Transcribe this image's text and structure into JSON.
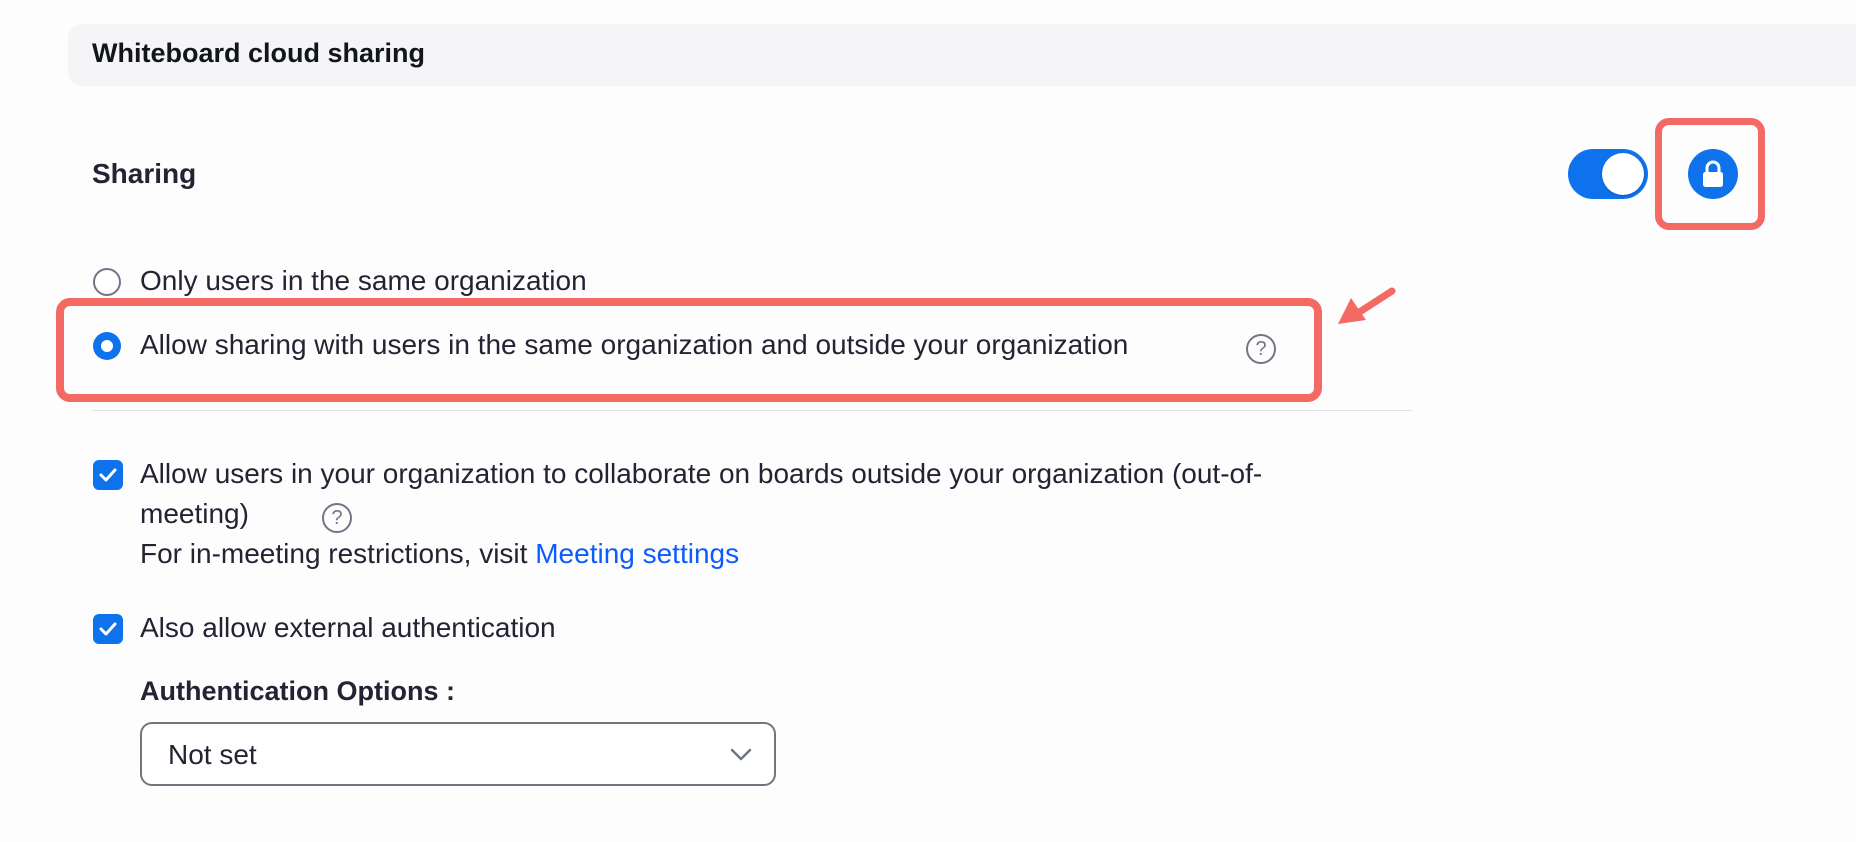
{
  "section": {
    "title": "Whiteboard cloud sharing"
  },
  "sharing": {
    "label": "Sharing",
    "toggle_state": "on",
    "locked": true,
    "options": [
      {
        "label": "Only users in the same organization",
        "selected": false
      },
      {
        "label": "Allow sharing with users in the same organization and outside your organization",
        "selected": true
      }
    ],
    "help_glyph": "?"
  },
  "collaborate": {
    "checked": true,
    "label": "Allow users in your organization to collaborate on boards outside your organization (out-of-meeting)",
    "sub_text": "For in-meeting restrictions, visit ",
    "link_text": "Meeting settings"
  },
  "external_auth": {
    "checked": true,
    "label": "Also allow external authentication",
    "options_label": "Authentication Options :",
    "selected_value": "Not set"
  },
  "icons": {
    "lock": "lock-icon",
    "help": "help-circle-icon",
    "check": "checkmark-icon",
    "chevron": "chevron-down-icon",
    "annotation_arrow": "arrow-icon"
  },
  "colors": {
    "accent": "#0e72ed",
    "highlight": "#f26a63",
    "link": "#0b5cff",
    "header_bg": "#f5f5f8"
  }
}
